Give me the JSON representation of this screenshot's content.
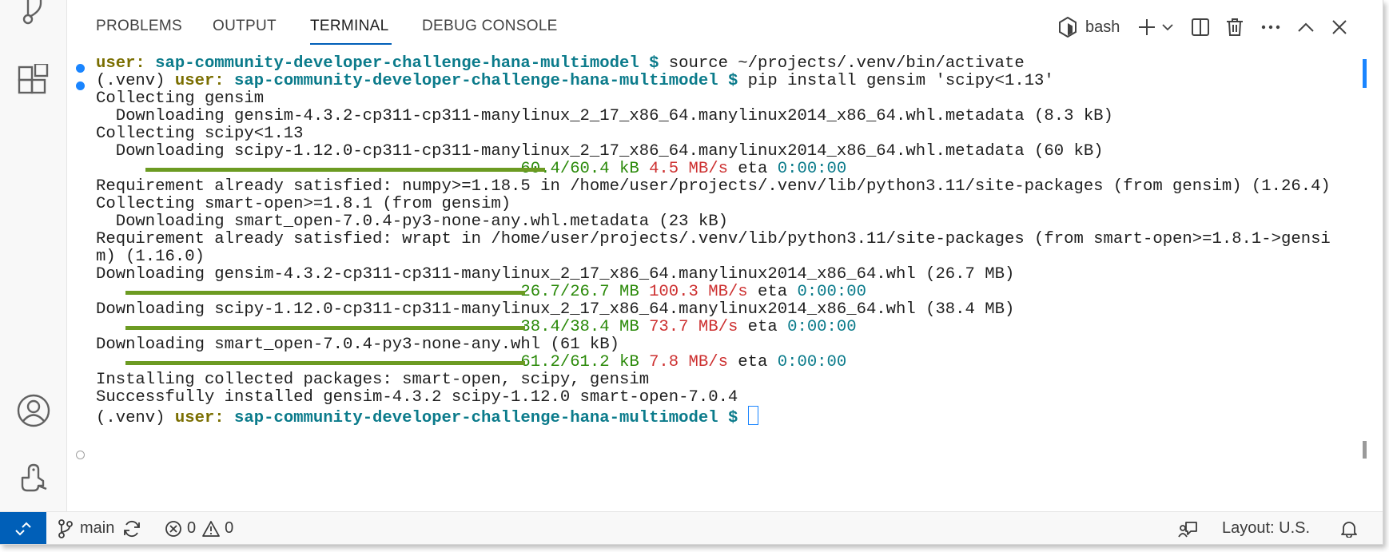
{
  "activity_bar": {
    "icons": [
      "source-control-icon",
      "extensions-icon",
      "accounts-icon",
      "deploy-icon"
    ]
  },
  "panel": {
    "tabs": [
      {
        "label": "PROBLEMS",
        "active": false
      },
      {
        "label": "OUTPUT",
        "active": false
      },
      {
        "label": "TERMINAL",
        "active": true
      },
      {
        "label": "DEBUG CONSOLE",
        "active": false
      }
    ],
    "shell_name": "bash"
  },
  "terminal": {
    "lines": [
      {
        "indent": "",
        "parts": [
          {
            "t": "user:",
            "s": "u"
          },
          {
            "t": " ",
            "s": ""
          },
          {
            "t": "sap-community-developer-challenge-hana-multimodel $",
            "s": "p"
          },
          {
            "t": " source ~/projects/.venv/bin/activate",
            "s": ""
          }
        ]
      },
      {
        "indent": "",
        "parts": [
          {
            "t": "(.venv) ",
            "s": ""
          },
          {
            "t": "user:",
            "s": "u"
          },
          {
            "t": " ",
            "s": ""
          },
          {
            "t": "sap-community-developer-challenge-hana-multimodel $",
            "s": "p"
          },
          {
            "t": " pip install gensim 'scipy<1.13'",
            "s": ""
          }
        ]
      },
      {
        "indent": "",
        "parts": [
          {
            "t": "Collecting gensim",
            "s": ""
          }
        ]
      },
      {
        "indent": "  ",
        "parts": [
          {
            "t": "Downloading gensim-4.3.2-cp311-cp311-manylinux_2_17_x86_64.manylinux2014_x86_64.whl.metadata (8.3 kB)",
            "s": ""
          }
        ]
      },
      {
        "indent": "",
        "parts": [
          {
            "t": "Collecting scipy<1.13",
            "s": ""
          }
        ]
      },
      {
        "indent": "  ",
        "parts": [
          {
            "t": "Downloading scipy-1.12.0-cp311-cp311-manylinux_2_17_x86_64.manylinux2014_x86_64.whl.metadata (60 kB)",
            "s": ""
          }
        ]
      },
      {
        "indent": "                                           ",
        "parts": [
          {
            "t": "60.4/60.4 kB",
            "s": "g"
          },
          {
            "t": " ",
            "s": ""
          },
          {
            "t": "4.5 MB/s",
            "s": "r"
          },
          {
            "t": " eta ",
            "s": ""
          },
          {
            "t": "0:00:00",
            "s": "c"
          }
        ]
      },
      {
        "indent": "",
        "parts": [
          {
            "t": "Requirement already satisfied: numpy>=1.18.5 in /home/user/projects/.venv/lib/python3.11/site-packages (from gensim) (1.26.4)",
            "s": ""
          }
        ]
      },
      {
        "indent": "",
        "parts": [
          {
            "t": "Collecting smart-open>=1.8.1 (from gensim)",
            "s": ""
          }
        ]
      },
      {
        "indent": "  ",
        "parts": [
          {
            "t": "Downloading smart_open-7.0.4-py3-none-any.whl.metadata (23 kB)",
            "s": ""
          }
        ]
      },
      {
        "indent": "",
        "parts": [
          {
            "t": "Requirement already satisfied: wrapt in /home/user/projects/.venv/lib/python3.11/site-packages (from smart-open>=1.8.1->gensi",
            "s": ""
          }
        ]
      },
      {
        "indent": "",
        "parts": [
          {
            "t": "m) (1.16.0)",
            "s": ""
          }
        ]
      },
      {
        "indent": "",
        "parts": [
          {
            "t": "Downloading gensim-4.3.2-cp311-cp311-manylinux_2_17_x86_64.manylinux2014_x86_64.whl (26.7 MB)",
            "s": ""
          }
        ]
      },
      {
        "indent": "                                           ",
        "parts": [
          {
            "t": "26.7/26.7 MB",
            "s": "g"
          },
          {
            "t": " ",
            "s": ""
          },
          {
            "t": "100.3 MB/s",
            "s": "r"
          },
          {
            "t": " eta ",
            "s": ""
          },
          {
            "t": "0:00:00",
            "s": "c"
          }
        ]
      },
      {
        "indent": "",
        "parts": [
          {
            "t": "Downloading scipy-1.12.0-cp311-cp311-manylinux_2_17_x86_64.manylinux2014_x86_64.whl (38.4 MB)",
            "s": ""
          }
        ]
      },
      {
        "indent": "                                           ",
        "parts": [
          {
            "t": "38.4/38.4 MB",
            "s": "g"
          },
          {
            "t": " ",
            "s": ""
          },
          {
            "t": "73.7 MB/s",
            "s": "r"
          },
          {
            "t": " eta ",
            "s": ""
          },
          {
            "t": "0:00:00",
            "s": "c"
          }
        ]
      },
      {
        "indent": "",
        "parts": [
          {
            "t": "Downloading smart_open-7.0.4-py3-none-any.whl (61 kB)",
            "s": ""
          }
        ]
      },
      {
        "indent": "                                           ",
        "parts": [
          {
            "t": "61.2/61.2 kB",
            "s": "g"
          },
          {
            "t": " ",
            "s": ""
          },
          {
            "t": "7.8 MB/s",
            "s": "r"
          },
          {
            "t": " eta ",
            "s": ""
          },
          {
            "t": "0:00:00",
            "s": "c"
          }
        ]
      },
      {
        "indent": "",
        "parts": [
          {
            "t": "Installing collected packages: smart-open, scipy, gensim",
            "s": ""
          }
        ]
      },
      {
        "indent": "",
        "parts": [
          {
            "t": "Successfully installed gensim-4.3.2 scipy-1.12.0 smart-open-7.0.4",
            "s": ""
          }
        ]
      },
      {
        "indent": "",
        "parts": [
          {
            "t": "(.venv) ",
            "s": ""
          },
          {
            "t": "user:",
            "s": "u"
          },
          {
            "t": " ",
            "s": ""
          },
          {
            "t": "sap-community-developer-challenge-hana-multimodel $",
            "s": "p"
          },
          {
            "t": " ",
            "s": ""
          }
        ]
      }
    ],
    "progress": [
      1.0,
      1.0,
      1.0,
      1.0
    ]
  },
  "status_bar": {
    "branch": "main",
    "errors": "0",
    "warnings": "0",
    "layout": "Layout: U.S."
  },
  "colors": {
    "accent": "#005fb8",
    "prompt_user": "#7a6e00",
    "prompt_path": "#0b7b8b",
    "progress_bar": "#6c9b22",
    "speed_red": "#cd3131"
  }
}
